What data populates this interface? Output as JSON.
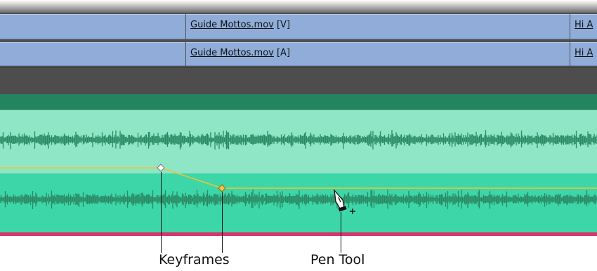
{
  "tracks": {
    "video": {
      "clip_name": "Guide Mottos.mov",
      "clip_suffix": " [V]",
      "next_clip_label": "Hi A"
    },
    "audio": {
      "clip_name": "Guide Mottos.mov",
      "clip_suffix": " [A]",
      "next_clip_label": "Hi A"
    }
  },
  "audio_clip": {
    "header_color": "#23845f",
    "upper_band_color": "#8fe6c6",
    "lower_band_color": "#3dd6a8",
    "waveform_color": "#2a8a64",
    "volume_line_color": "#f0c42e",
    "bottom_edge_color": "#d8336b"
  },
  "callouts": {
    "keyframes": "Keyframes",
    "pen_tool": "Pen Tool"
  },
  "icons": {
    "keyframe": "diamond-icon",
    "cursor": "pen-tool-cursor-icon"
  }
}
